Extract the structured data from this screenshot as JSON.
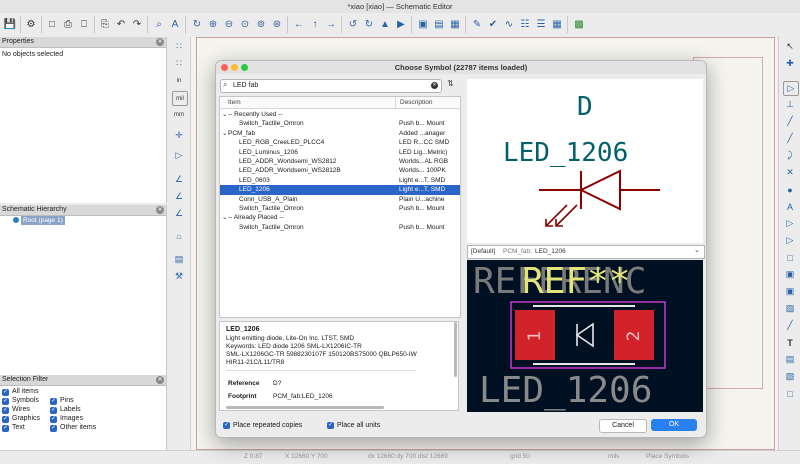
{
  "window": {
    "title": "*xiao [xiao] — Schematic Editor"
  },
  "properties": {
    "header": "Properties",
    "empty_text": "No objects selected"
  },
  "hierarchy": {
    "header": "Schematic Hierarchy",
    "root": "Root (page 1)"
  },
  "selection_filter": {
    "header": "Selection Filter",
    "items": [
      {
        "label": "All items",
        "checked": true
      },
      {
        "label": "Pins",
        "checked": true
      },
      {
        "label": "Symbols",
        "checked": true
      },
      {
        "label": "Labels",
        "checked": true
      },
      {
        "label": "Wires",
        "checked": true
      },
      {
        "label": "Images",
        "checked": true
      },
      {
        "label": "Graphics",
        "checked": true
      },
      {
        "label": "Other items",
        "checked": true
      },
      {
        "label": "Text",
        "checked": true
      }
    ]
  },
  "left_toolbar": {
    "units": [
      "in",
      "mil",
      "mm"
    ]
  },
  "status_bar": {
    "zoom": "Z 0.87",
    "cursor": "X 12660  Y 700",
    "delta": "dx 12660  dy 700  dist 12669",
    "grid": "grid 50",
    "units": "mils",
    "mode": "Place Symbols"
  },
  "dialog": {
    "title": "Choose Symbol (22787 items loaded)",
    "search_value": "LED fab",
    "col_item": "Item",
    "col_desc": "Description",
    "rows": [
      {
        "name": "-- Recently Used --",
        "desc": "",
        "level": 0,
        "expander": "⌄",
        "selected": false
      },
      {
        "name": "Switch_Tactile_Omron",
        "desc": "Push b... Mount",
        "level": 1,
        "expander": "",
        "selected": false
      },
      {
        "name": "PCM_fab",
        "desc": "Added ...anager",
        "level": 0,
        "expander": "⌄",
        "selected": false
      },
      {
        "name": "LED_RGB_CreeLED_PLCC4",
        "desc": "LED R...CC SMD",
        "level": 1,
        "expander": "",
        "selected": false
      },
      {
        "name": "LED_Luminus_1206",
        "desc": "LED Lig...Metric)",
        "level": 1,
        "expander": "",
        "selected": false
      },
      {
        "name": "LED_ADDR_Worldsemi_WS2812",
        "desc": "Worlds...AL RGB",
        "level": 1,
        "expander": "",
        "selected": false
      },
      {
        "name": "LED_ADDR_Worldsemi_WS2812B",
        "desc": "Worlds... 100PK",
        "level": 1,
        "expander": "",
        "selected": false
      },
      {
        "name": "LED_0603",
        "desc": "Light e...T, SMD",
        "level": 1,
        "expander": "",
        "selected": false
      },
      {
        "name": "LED_1206",
        "desc": "Light e...T, SMD",
        "level": 1,
        "expander": "",
        "selected": true
      },
      {
        "name": "Conn_USB_A_Plain",
        "desc": "Plain U...achine",
        "level": 1,
        "expander": "",
        "selected": false
      },
      {
        "name": "Switch_Tactile_Omron",
        "desc": "Push b... Mount",
        "level": 1,
        "expander": "",
        "selected": false
      },
      {
        "name": "-- Already Placed --",
        "desc": "",
        "level": 0,
        "expander": "⌄",
        "selected": false
      },
      {
        "name": "Switch_Tactile_Omron",
        "desc": "Push b... Mount",
        "level": 1,
        "expander": "",
        "selected": false
      }
    ],
    "details": {
      "name": "LED_1206",
      "line1": "Light emitting diode, Lite-On Inc. LTST, SMD",
      "line2": "Keywords: LED diode 1206 SML-LX1206IC-TR",
      "line3": "SML-LX1206GC-TR 5988230107F 150120BS75000 QBLP650-IW",
      "line4": "HIR11-21C/L11/TR8",
      "reference_label": "Reference",
      "reference_value": "D?",
      "footprint_label": "Footprint",
      "footprint_value": "PCM_fab:LED_1206"
    },
    "symbol_preview": {
      "reference": "D",
      "value": "LED_1206"
    },
    "footprint_select": {
      "prefix": "[Default]",
      "lib": "PCM_fab:",
      "name": "LED_1206"
    },
    "footprint_preview": {
      "ref_text": "REF**",
      "name_text": "LED_1206",
      "ref_bg": "REFERENC",
      "pad1": "1",
      "pad2": "2"
    },
    "place_repeated": {
      "label": "Place repeated copies",
      "checked": true
    },
    "place_all_units": {
      "label": "Place all units",
      "checked": true
    },
    "cancel": "Cancel",
    "ok": "OK"
  },
  "colors": {
    "accent": "#2a66c8",
    "symbol_text": "#00616a",
    "symbol_body": "#8b0000",
    "pad": "#d2232a",
    "fp_bg": "#001023",
    "courtyard": "#d43fd4"
  }
}
